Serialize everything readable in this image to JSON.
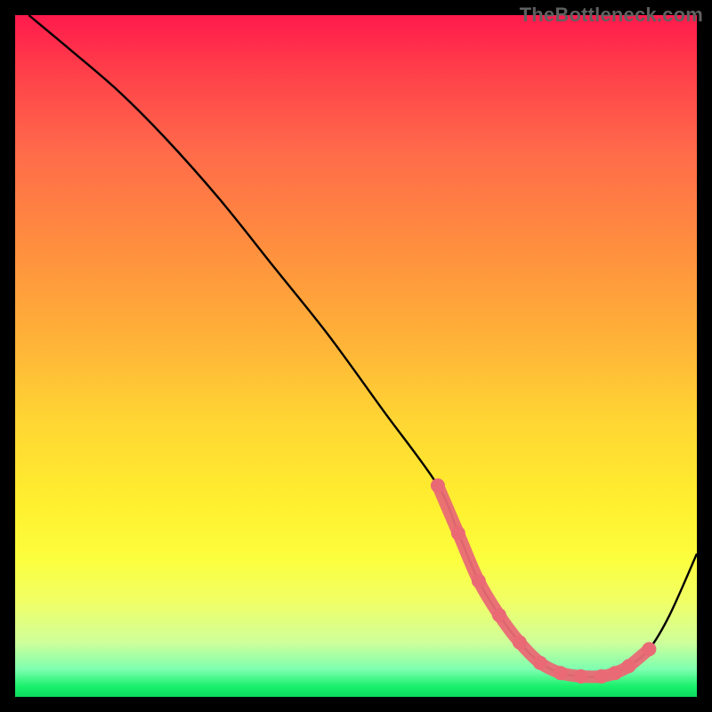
{
  "watermark": "TheBottleneck.com",
  "chart_data": {
    "type": "line",
    "title": "",
    "xlabel": "",
    "ylabel": "",
    "xlim": [
      0,
      100
    ],
    "ylim": [
      0,
      100
    ],
    "grid": false,
    "series": [
      {
        "name": "bottleneck-curve",
        "color": "#000000",
        "x": [
          2,
          8,
          15,
          22,
          30,
          38,
          46,
          54,
          62,
          65,
          68,
          71,
          74,
          77,
          80,
          83,
          86,
          88,
          90,
          93,
          96,
          100
        ],
        "y": [
          100,
          95,
          89,
          82,
          73,
          63,
          53,
          42,
          31,
          24,
          17,
          12,
          8,
          5,
          3.5,
          3,
          3,
          3.5,
          4.5,
          7,
          12,
          21
        ]
      },
      {
        "name": "optimal-range-highlight",
        "color": "#e96a75",
        "x": [
          62,
          65,
          68,
          71,
          74,
          77,
          80,
          83,
          86,
          88,
          90,
          93
        ],
        "y": [
          31,
          24,
          17,
          12,
          8,
          5,
          3.5,
          3,
          3,
          3.5,
          4.5,
          7
        ],
        "style": "thick-dotted"
      }
    ],
    "gradient_stops": [
      {
        "pos": 0,
        "color": "#ff1a4c"
      },
      {
        "pos": 50,
        "color": "#ffd733"
      },
      {
        "pos": 95,
        "color": "#cfff9a"
      },
      {
        "pos": 100,
        "color": "#0bd95f"
      }
    ]
  }
}
